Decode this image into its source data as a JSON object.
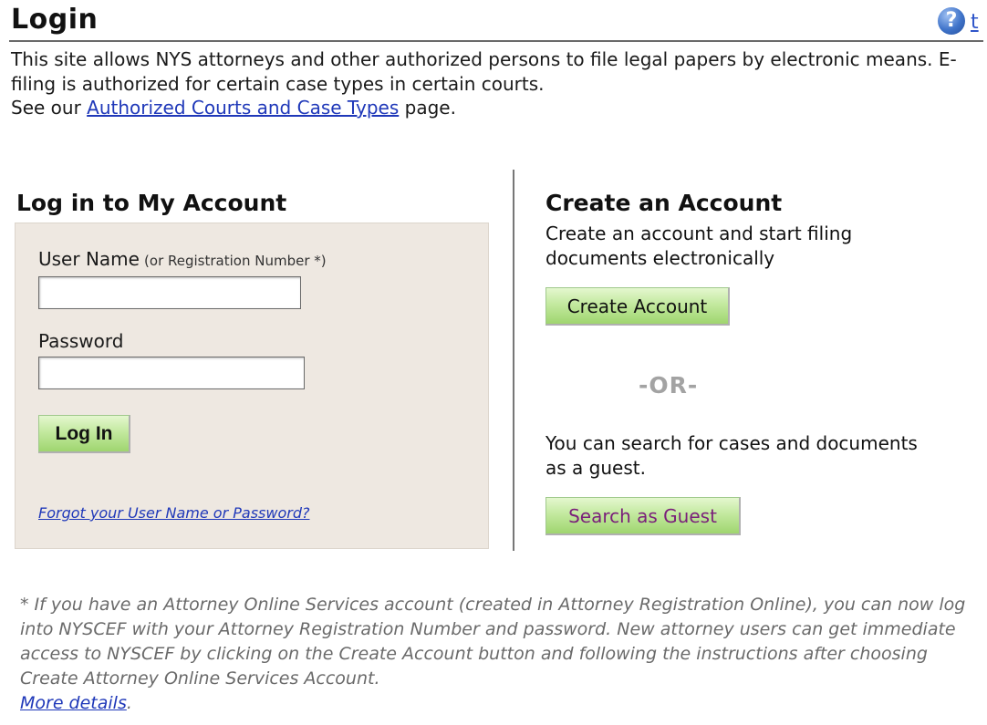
{
  "header": {
    "title": "Login",
    "help_icon": "question-icon",
    "help_link_text": "t"
  },
  "intro": {
    "line1": "This site allows NYS attorneys and other authorized persons to file legal papers by electronic means. E-filing is authorized for certain case types in certain courts.",
    "see_prefix": "See our ",
    "link_text": "Authorized Courts and Case Types",
    "see_suffix": " page."
  },
  "login": {
    "heading": "Log in to My Account",
    "username_label": "User Name",
    "username_sublabel": "(or Registration Number *)",
    "username_value": "",
    "password_label": "Password",
    "password_value": "",
    "login_button": "Log In",
    "forgot_link": "Forgot your User Name or Password?"
  },
  "create": {
    "heading": "Create an Account",
    "description": "Create an account and start filing documents electronically",
    "button": "Create Account",
    "or_text": "-OR-",
    "guest_description": "You can search for cases and documents as a guest.",
    "guest_button": "Search as Guest"
  },
  "footnote": {
    "text": "* If you have an Attorney Online Services account (created in Attorney Registration Online), you can now log into NYSCEF with your Attorney Registration Number and password.  New attorney users can get immediate access to NYSCEF by clicking on the Create Account button and following the instructions after choosing Create Attorney Online Services Account.",
    "link_text": "More details",
    "link_suffix": "."
  },
  "colors": {
    "link": "#1f38b9",
    "login_box_bg": "#eee8e1",
    "button_green": "#c3e99f",
    "or_gray": "#a3a3a3",
    "footnote_gray": "#6a6a6a"
  }
}
